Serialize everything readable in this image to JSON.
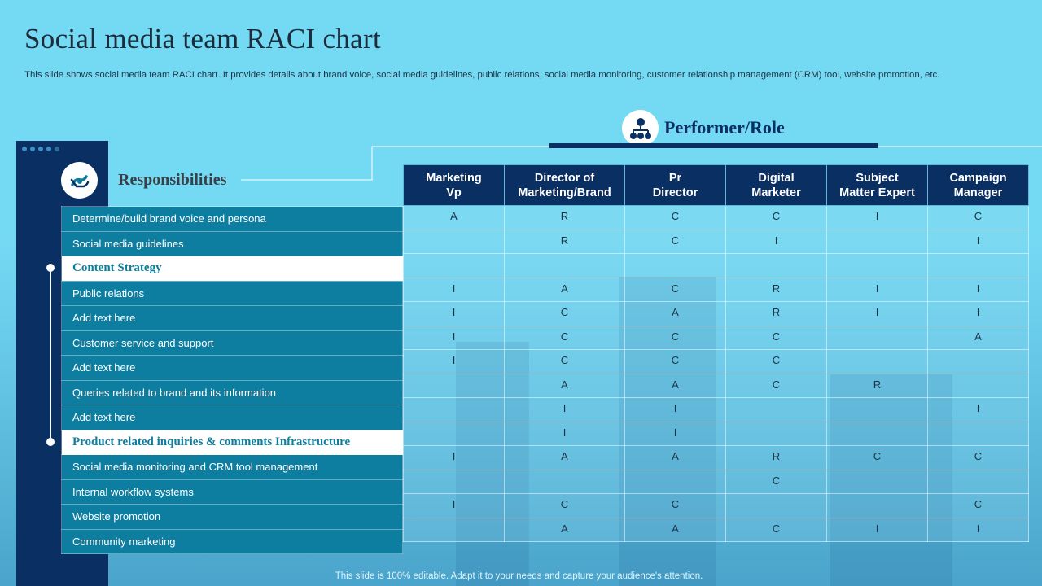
{
  "title": "Social media team RACI chart",
  "subtitle": "This slide shows social media team RACI chart. It provides details about brand voice, social media guidelines, public relations, social media monitoring, customer relationship management (CRM) tool, website promotion, etc.",
  "responsibilities_label": "Responsibilities",
  "performer_label": "Performer/Role",
  "colors": {
    "navy": "#0a2f63",
    "teal": "#0e7ea0",
    "background": "#74d9f3"
  },
  "icons": {
    "responsibilities": "handshake-icon",
    "performer": "org-chart-icon"
  },
  "roles": [
    [
      "Marketing",
      "Vp"
    ],
    [
      "Director of",
      "Marketing/Brand"
    ],
    [
      "Pr",
      "Director"
    ],
    [
      "Digital",
      "Marketer"
    ],
    [
      "Subject",
      "Matter Expert"
    ],
    [
      "Campaign",
      "Manager"
    ]
  ],
  "rows": [
    {
      "label": "Determine/build  brand voice  and persona",
      "section": false,
      "values": [
        "A",
        "R",
        "C",
        "C",
        "I",
        "C"
      ]
    },
    {
      "label": "Social media guidelines",
      "section": false,
      "values": [
        "",
        "R",
        "C",
        "I",
        "",
        "I"
      ]
    },
    {
      "label": "Content  Strategy",
      "section": true,
      "values": [
        "",
        "",
        "",
        "",
        "",
        ""
      ]
    },
    {
      "label": "Public relations",
      "section": false,
      "values": [
        "I",
        "A",
        "C",
        "R",
        "I",
        "I"
      ]
    },
    {
      "label": "Add text here",
      "section": false,
      "values": [
        "I",
        "C",
        "A",
        "R",
        "I",
        "I"
      ]
    },
    {
      "label": "Customer service  and support",
      "section": false,
      "values": [
        "I",
        "C",
        "C",
        "C",
        "",
        "A"
      ]
    },
    {
      "label": "Add text here",
      "section": false,
      "values": [
        "I",
        "C",
        "C",
        "C",
        "",
        ""
      ]
    },
    {
      "label": "Queries related to brand  and its information",
      "section": false,
      "values": [
        "",
        "A",
        "A",
        "C",
        "R",
        ""
      ]
    },
    {
      "label": "Add text here",
      "section": false,
      "values": [
        "",
        "I",
        "I",
        "",
        "",
        "I"
      ]
    },
    {
      "label": "Product  related  inquiries  &  comments  Infrastructure",
      "section": true,
      "values": [
        "",
        "I",
        "I",
        "",
        "",
        ""
      ]
    },
    {
      "label": "Social media monitoring and CRM tool management",
      "section": false,
      "values": [
        "I",
        "A",
        "A",
        "R",
        "C",
        "C"
      ]
    },
    {
      "label": "Internal  workflow  systems",
      "section": false,
      "values": [
        "",
        "",
        "",
        "C",
        "",
        ""
      ]
    },
    {
      "label": "Website promotion",
      "section": false,
      "values": [
        "I",
        "C",
        "C",
        "",
        "",
        "C"
      ]
    },
    {
      "label": "Community  marketing",
      "section": false,
      "values": [
        "",
        "A",
        "A",
        "C",
        "I",
        "I"
      ]
    }
  ],
  "footer": "This slide is 100% editable. Adapt it to your needs and capture your audience's attention."
}
